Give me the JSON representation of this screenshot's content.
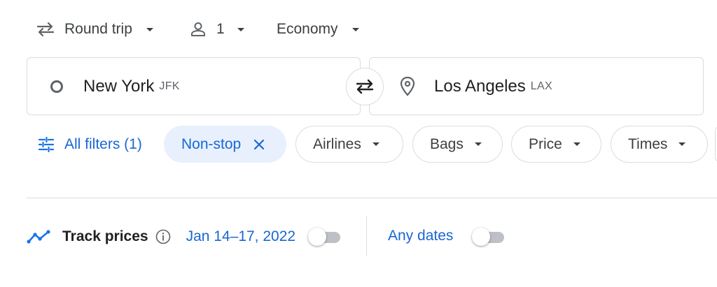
{
  "trip": {
    "trip_type": "Round trip",
    "passengers": "1",
    "cabin_class": "Economy"
  },
  "origin": {
    "city": "New York",
    "code": "JFK"
  },
  "destination": {
    "city": "Los Angeles",
    "code": "LAX"
  },
  "filters": {
    "all_filters": "All filters (1)",
    "nonstop": "Non-stop",
    "airlines": "Airlines",
    "bags": "Bags",
    "price": "Price",
    "times": "Times"
  },
  "tracking": {
    "label": "Track prices",
    "date_range": "Jan 14–17, 2022",
    "any_dates": "Any dates",
    "date_range_on": false,
    "any_dates_on": false
  },
  "colors": {
    "accent": "#1a73e8",
    "chip_active_bg": "#e8f0fe"
  }
}
